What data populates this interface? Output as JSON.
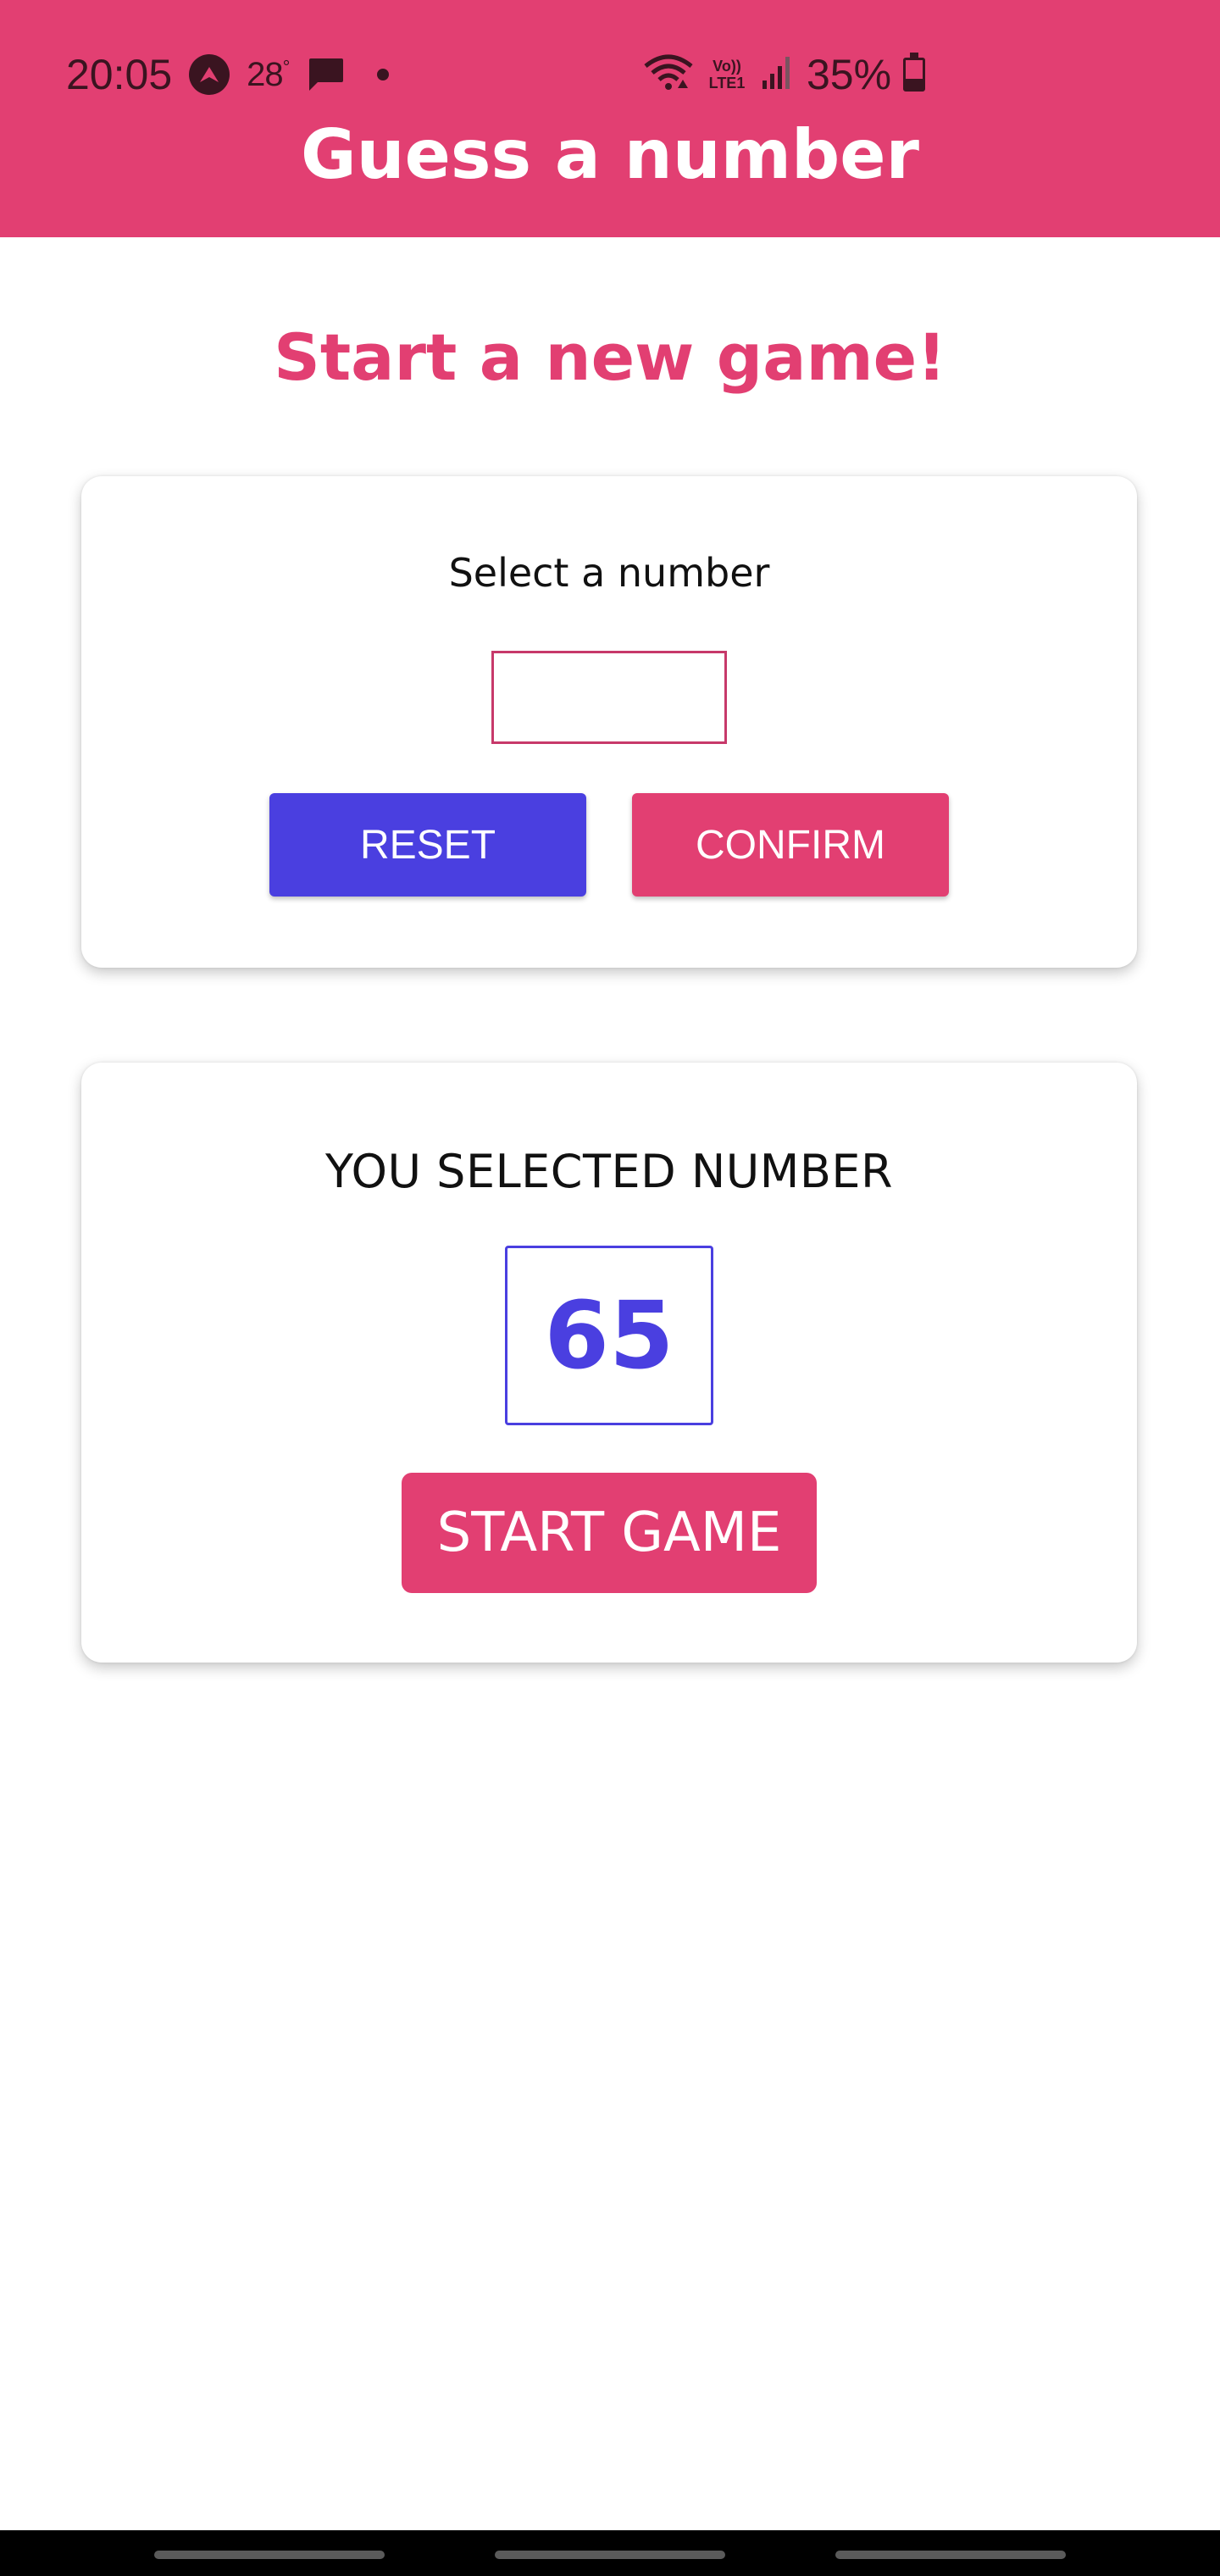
{
  "status_bar": {
    "time": "20:05",
    "temperature": "28",
    "temperature_unit": "°",
    "volte_line1": "Vo))",
    "volte_line2": "LTE1",
    "battery_text": "35%",
    "battery_level": 0.35,
    "icons": [
      "navigation-icon",
      "message-icon",
      "notification-dot-icon",
      "wifi-icon",
      "volte-icon",
      "signal-icon",
      "battery-icon"
    ]
  },
  "header": {
    "title": "Guess a number"
  },
  "main": {
    "title": "Start a new game!",
    "input_card": {
      "label": "Select a number",
      "input_value": "",
      "reset_label": "RESET",
      "confirm_label": "CONFIRM"
    },
    "selected_card": {
      "label": "YOU SELECTED NUMBER",
      "number": "65",
      "start_label": "START GAME"
    }
  },
  "colors": {
    "primary": "#e23f72",
    "accent": "#4a3fe0",
    "status_icons": "#3a1420",
    "background": "#ffffff"
  }
}
